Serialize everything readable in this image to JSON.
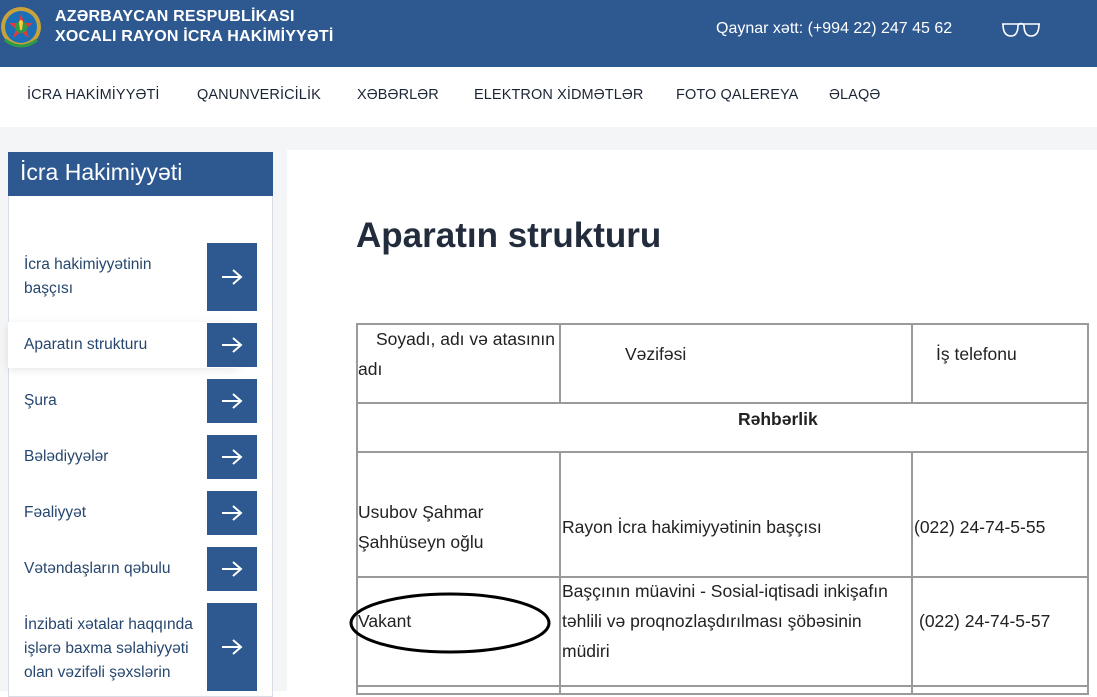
{
  "header": {
    "title_line1": "AZƏRBAYCAN RESPUBLİKASI",
    "title_line2": "XOCALI RAYON İCRA HAKİMİYYƏTİ",
    "hotline": "Qaynar xətt: (+994 22) 247 45 62",
    "emblem_icon": "azerbaijan-emblem-icon",
    "accessibility_icon": "glasses-icon",
    "colors": {
      "primary": "#2d5890",
      "background": "#f4f5f7"
    }
  },
  "nav": {
    "items": [
      {
        "label": "İCRA HAKİMİYYƏTİ"
      },
      {
        "label": "QANUNVERİCİLİK"
      },
      {
        "label": "XƏBƏRLƏR"
      },
      {
        "label": "ELEKTRON XİDMƏTLƏR"
      },
      {
        "label": "FOTO QALEREYA"
      },
      {
        "label": "ƏLAQƏ"
      }
    ]
  },
  "sidebar": {
    "title": "İcra Hakimiyyəti",
    "items": [
      {
        "label_lines": [
          "İcra hakimiyyətinin",
          "başçısı"
        ]
      },
      {
        "label_lines": [
          "Aparatın strukturu"
        ],
        "active": true
      },
      {
        "label_lines": [
          "Şura"
        ]
      },
      {
        "label_lines": [
          "Bələdiyyələr"
        ]
      },
      {
        "label_lines": [
          "Fəaliyyət"
        ]
      },
      {
        "label_lines": [
          "Vətəndaşların qəbulu"
        ]
      },
      {
        "label_lines": [
          "İnzibati xətalar haqqında",
          "işlərə baxma səlahiyyəti",
          "olan vəzifəli şəxslərin"
        ]
      }
    ],
    "arrow_icon": "arrow-right-icon"
  },
  "main": {
    "page_title": "Aparatın strukturu",
    "table": {
      "headers": {
        "name_line1": "Soyadı, adı və atasının",
        "name_line2": "adı",
        "position": "Vəzifəsi",
        "phone": "İş telefonu"
      },
      "section": "Rəhbərlik",
      "rows": [
        {
          "name_line1": "Usubov Şahmar",
          "name_line2": "Şahhüseyn oğlu",
          "position": "Rayon İcra hakimiyyətinin başçısı",
          "phone": "(022) 24-74-5-55"
        },
        {
          "name": "Vakant",
          "position_line1": "Başçının müavini - Sosial-iqtisadi inkişafın",
          "position_line2": "təhlili və proqnozlaşdırılması şöbəsinin",
          "position_line3": "müdiri",
          "phone": "(022) 24-74-5-57"
        }
      ]
    }
  }
}
